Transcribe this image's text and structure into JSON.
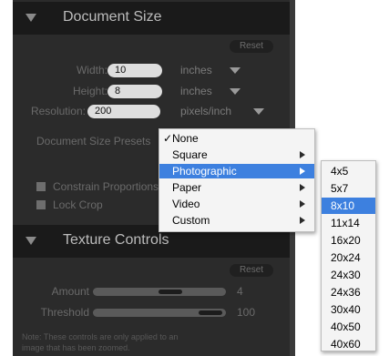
{
  "document_size": {
    "title": "Document Size",
    "reset_label": "Reset",
    "width": {
      "label": "Width:",
      "value": "10",
      "unit": "inches"
    },
    "height": {
      "label": "Height:",
      "value": "8",
      "unit": "inches"
    },
    "resolution": {
      "label": "Resolution:",
      "value": "200",
      "unit": "pixels/inch"
    },
    "preset_label": "Document Size Presets",
    "constrain_label": "Constrain Proportions",
    "lock_crop_label": "Lock Crop"
  },
  "texture_controls": {
    "title": "Texture Controls",
    "reset_label": "Reset",
    "amount": {
      "label": "Amount",
      "value": "4"
    },
    "threshold": {
      "label": "Threshold",
      "value": "100"
    },
    "note_line1": "Note: These controls are only applied to an",
    "note_line2": "image that has been zoomed."
  },
  "preset_menu": {
    "check_mark": "✓",
    "items": [
      "None",
      "Square",
      "Photographic",
      "Paper",
      "Video",
      "Custom"
    ],
    "selected": "None",
    "highlighted": "Photographic"
  },
  "photographic_submenu": {
    "items": [
      "4x5",
      "5x7",
      "8x10",
      "11x14",
      "16x20",
      "20x24",
      "24x30",
      "24x36",
      "30x40",
      "40x50",
      "40x60"
    ],
    "highlighted": "8x10"
  }
}
